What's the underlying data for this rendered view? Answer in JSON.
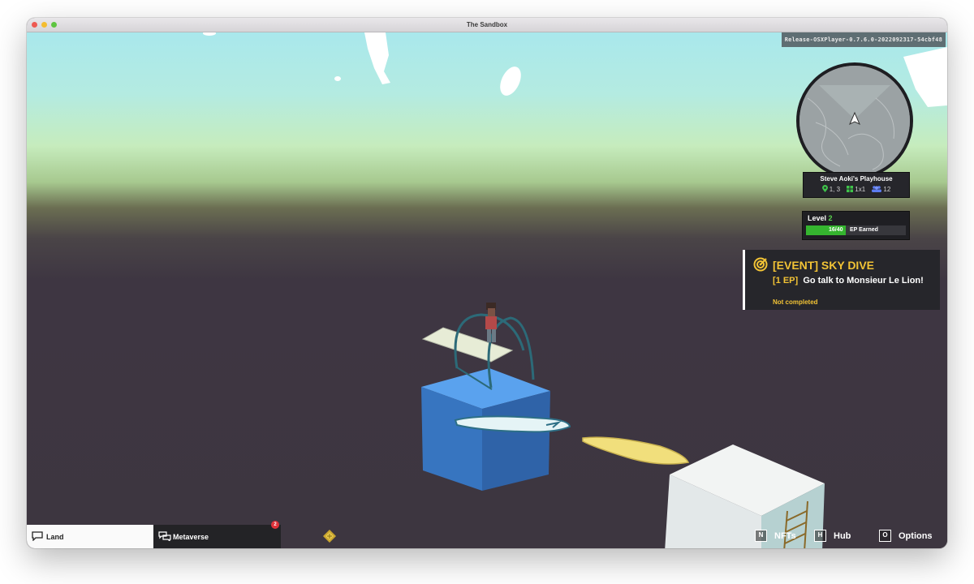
{
  "window": {
    "title": "The Sandbox"
  },
  "build": {
    "label": "Release-OSXPlayer-0.7.6.0-2022092317-54cbf48"
  },
  "minimap": {
    "location_name": "Steve Aoki's Playhouse",
    "coordinates": "1, 3",
    "size": "1x1",
    "players": "12",
    "icons": [
      "location-pin-icon",
      "land-grid-icon",
      "players-icon"
    ]
  },
  "level": {
    "label": "Level",
    "value": "2",
    "ep_text": "16/40",
    "ep_label": "EP Earned",
    "ep_fraction": 0.4,
    "accent": "#35b52f"
  },
  "quest": {
    "title": "[EVENT] SKY DIVE",
    "ep": "[1 EP]",
    "task": "Go talk to Monsieur Le Lion!",
    "status": "Not completed",
    "accent": "#f2c335",
    "icon": "target-icon"
  },
  "bottom_bar": {
    "tabs": [
      {
        "label": "Land",
        "icon": "chat-bubble-icon",
        "active": true
      },
      {
        "label": "Metaverse",
        "icon": "chat-bubbles-icon",
        "badge": "2"
      }
    ],
    "emblem_icon": "sandbox-logo-icon",
    "hotkeys": [
      {
        "key": "N",
        "label": "NFTs"
      },
      {
        "key": "H",
        "label": "Hub"
      },
      {
        "key": "O",
        "label": "Options"
      }
    ]
  }
}
